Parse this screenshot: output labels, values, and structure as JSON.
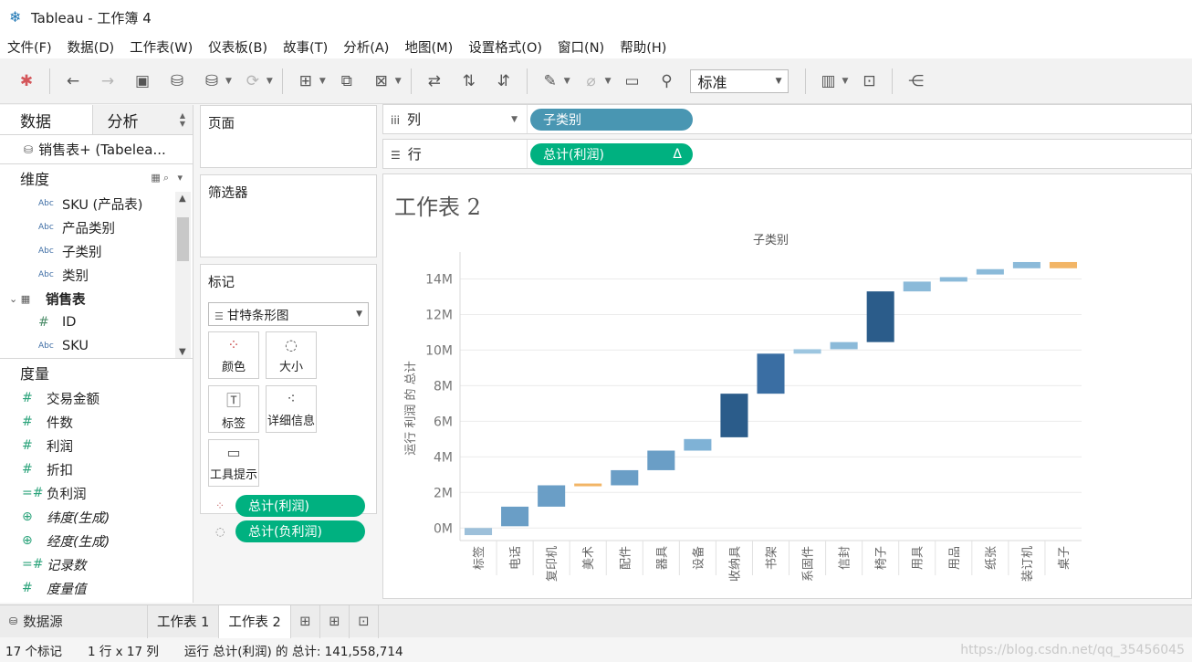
{
  "window": {
    "title": "Tableau - 工作簿 4"
  },
  "menu": [
    "文件(F)",
    "数据(D)",
    "工作表(W)",
    "仪表板(B)",
    "故事(T)",
    "分析(A)",
    "地图(M)",
    "设置格式(O)",
    "窗口(N)",
    "帮助(H)"
  ],
  "toolbar": {
    "fit_value": "标准"
  },
  "data_pane": {
    "tab_data": "数据",
    "tab_analysis": "分析",
    "datasource": "销售表+ (Tabelea...",
    "dimensions_label": "维度",
    "dimensions": [
      {
        "label": "SKU (产品表)",
        "type": "Abc"
      },
      {
        "label": "产品类别",
        "type": "Abc"
      },
      {
        "label": "子类别",
        "type": "Abc"
      },
      {
        "label": "类别",
        "type": "Abc"
      },
      {
        "label": "销售表",
        "type": "table"
      },
      {
        "label": "ID",
        "type": "#"
      },
      {
        "label": "SKU",
        "type": "Abc"
      }
    ],
    "measures_label": "度量",
    "measures": [
      {
        "label": "交易金额"
      },
      {
        "label": "件数"
      },
      {
        "label": "利润"
      },
      {
        "label": "折扣"
      },
      {
        "label": "负利润"
      },
      {
        "label": "纬度(生成)"
      },
      {
        "label": "经度(生成)"
      },
      {
        "label": "记录数"
      },
      {
        "label": "度量值"
      }
    ]
  },
  "shelves": {
    "pages_label": "页面",
    "filters_label": "筛选器",
    "marks_label": "标记",
    "mark_type": "甘特条形图",
    "mark_buttons": [
      "颜色",
      "大小",
      "标签",
      "详细信息",
      "工具提示"
    ],
    "mark_pills": [
      "总计(利润)",
      "总计(负利润)"
    ],
    "columns_label": "列",
    "columns_pill": "子类别",
    "rows_label": "行",
    "rows_pill": "总计(利润)",
    "rows_pill_delta": "Δ"
  },
  "view": {
    "sheet_title": "工作表 2"
  },
  "chart_data": {
    "type": "bar",
    "title": "",
    "xlabel": "子类别",
    "ylabel": "运行 利润 的 总计",
    "ylim": [
      -0.5,
      15
    ],
    "y_ticks": [
      0,
      2,
      4,
      6,
      8,
      10,
      12,
      14
    ],
    "y_tick_labels": [
      "0M",
      "2M",
      "4M",
      "6M",
      "8M",
      "10M",
      "12M",
      "14M"
    ],
    "categories": [
      "标签",
      "电话",
      "复印机",
      "美术",
      "配件",
      "器具",
      "设备",
      "收纳具",
      "书架",
      "系固件",
      "信封",
      "椅子",
      "用具",
      "用品",
      "纸张",
      "装订机",
      "桌子"
    ],
    "start": [
      0.0,
      0.1,
      1.2,
      2.4,
      2.4,
      3.25,
      4.35,
      5.1,
      7.55,
      9.8,
      10.05,
      10.45,
      13.3,
      13.85,
      14.25,
      14.6,
      14.95
    ],
    "end": [
      -0.4,
      1.2,
      2.4,
      2.5,
      3.25,
      4.35,
      5.0,
      7.55,
      9.8,
      10.05,
      10.45,
      13.3,
      13.85,
      14.1,
      14.55,
      14.95,
      14.6
    ],
    "colors": [
      "#9dc0da",
      "#6a9ec6",
      "#6a9ec6",
      "#f2b566",
      "#6a9ec6",
      "#6a9ec6",
      "#7fb2d6",
      "#2b5c8a",
      "#3a6ea3",
      "#9dc6e0",
      "#8bbad9",
      "#2b5c8a",
      "#8bbad9",
      "#8bbad9",
      "#8bbad9",
      "#8bbad9",
      "#f2b566"
    ]
  },
  "bottom_tabs": {
    "source": "数据源",
    "sheets": [
      "工作表 1",
      "工作表 2"
    ]
  },
  "status": {
    "marks": "17 个标记",
    "rows_cols": "1 行 x 17 列",
    "sum": "运行 总计(利润) 的 总计: 141,558,714"
  },
  "watermark": "https://blog.csdn.net/qq_35456045"
}
